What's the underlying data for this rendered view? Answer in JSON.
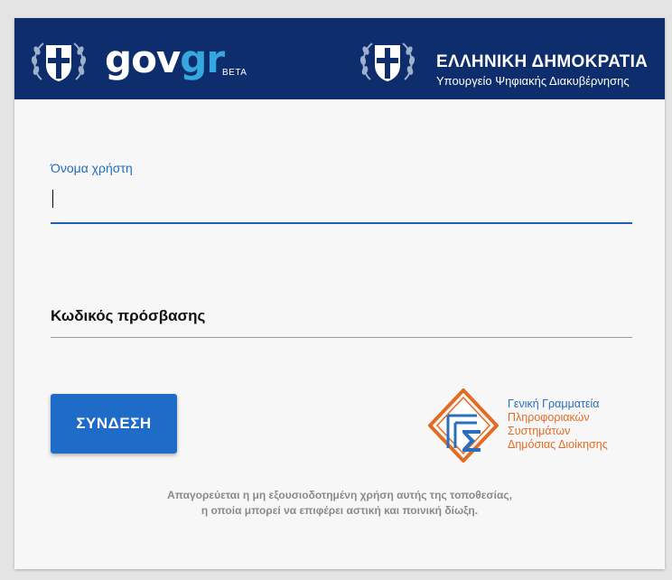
{
  "header": {
    "brand_gov": "gov",
    "brand_gr": "gr",
    "brand_beta": "BETA",
    "republic": "ΕΛΛΗΝΙΚΗ ΔΗΜΟΚΡΑΤΙΑ",
    "ministry": "Υπουργείο Ψηφιακής Διακυβέρνησης",
    "colors": {
      "background": "#0d2d6c",
      "gr_accent": "#35a8e0"
    }
  },
  "form": {
    "username_label": "Όνομα χρήστη",
    "username_value": "",
    "password_label": "Κωδικός πρόσβασης",
    "password_value": "",
    "login_button": "ΣΥΝΔΕΣΗ",
    "colors": {
      "primary": "#1e6cc8"
    }
  },
  "gsis": {
    "icon": "gsis-logo",
    "line1": "Γενική Γραμματεία",
    "line2": "Πληροφοριακών",
    "line3": "Συστημάτων",
    "line4": "Δημόσιας Διοίκησης",
    "colors": {
      "blue": "#2a6fbe",
      "orange": "#e36c25"
    }
  },
  "footer": {
    "warning_line1": "Απαγορεύεται η μη εξουσιοδοτημένη χρήση αυτής της τοποθεσίας,",
    "warning_line2": "η οποία μπορεί να επιφέρει αστική και ποινική δίωξη."
  }
}
